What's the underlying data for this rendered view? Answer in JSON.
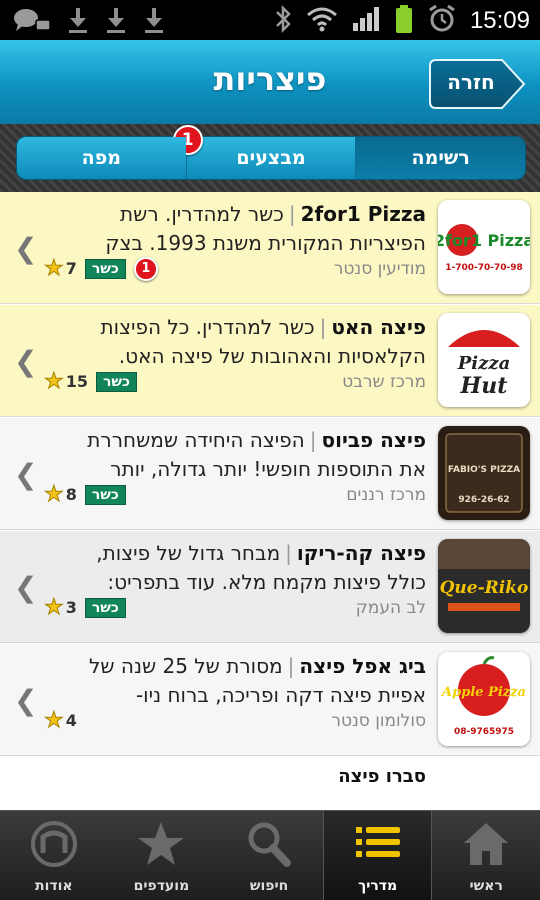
{
  "status_bar": {
    "time": "15:09"
  },
  "header": {
    "title": "פיצריות",
    "back_label": "חזרה"
  },
  "tabs": [
    {
      "label": "רשימה",
      "active": true
    },
    {
      "label": "מבצעים",
      "active": false,
      "badge": "1"
    },
    {
      "label": "מפה",
      "active": false
    }
  ],
  "list": [
    {
      "name": "2for1 Pizza",
      "line1_rest": "כשר למהדרין. רשת",
      "line2": "הפיצריות המקורית משנת 1993. בצק",
      "location": "מודיעין סנטר",
      "rating": "7",
      "kosher": "כשר",
      "badge": "1",
      "logo_text": "2for1 Pizza",
      "logo_phone": "1-700-70-70-98"
    },
    {
      "name": "פיצה האט",
      "line1_rest": "כשר למהדרין. כל הפיצות",
      "line2": "הקלאסיות והאהובות של פיצה האט.",
      "location": "מרכז שרבט",
      "rating": "15",
      "kosher": "כשר",
      "logo_text_top": "Pizza",
      "logo_text_bottom": "Hut"
    },
    {
      "name": "פיצה פביוס",
      "line1_rest": "הפיצה היחידה שמשחררת",
      "line2": "את התוספות חופשי! יותר גדולה, יותר",
      "location": "מרכז רננים",
      "rating": "8",
      "kosher": "כשר",
      "logo_text": "FABIO'S PIZZA",
      "logo_phone": "926-26-62"
    },
    {
      "name": "פיצה קה-ריקו",
      "line1_rest": "מבחר גדול של פיצות,",
      "line2": "כולל פיצות מקמח מלא. עוד בתפריט:",
      "location": "לב העמק",
      "rating": "3",
      "kosher": "כשר",
      "logo_text": "Que-Riko"
    },
    {
      "name": "ביג אפל פיצה",
      "line1_rest": "מסורת של 25 שנה של",
      "line2": "אפיית פיצה דקה ופריכה, ברוח ניו-",
      "location": "סולומון סנטר",
      "rating": "4",
      "logo_text": "Apple Pizza",
      "logo_phone": "08-9765975"
    }
  ],
  "partial_item": {
    "name": "סברו פיצה"
  },
  "bottom_nav": [
    {
      "label": "ראשי",
      "icon": "home-icon"
    },
    {
      "label": "מדריך",
      "icon": "list-icon",
      "active": true
    },
    {
      "label": "חיפוש",
      "icon": "search-icon"
    },
    {
      "label": "מועדפים",
      "icon": "star-icon"
    },
    {
      "label": "אודות",
      "icon": "about-icon"
    }
  ],
  "colors": {
    "header": "#0e92c0",
    "featured_row": "#fbf8c4",
    "kosher": "#11845a",
    "badge": "#e0141c"
  }
}
